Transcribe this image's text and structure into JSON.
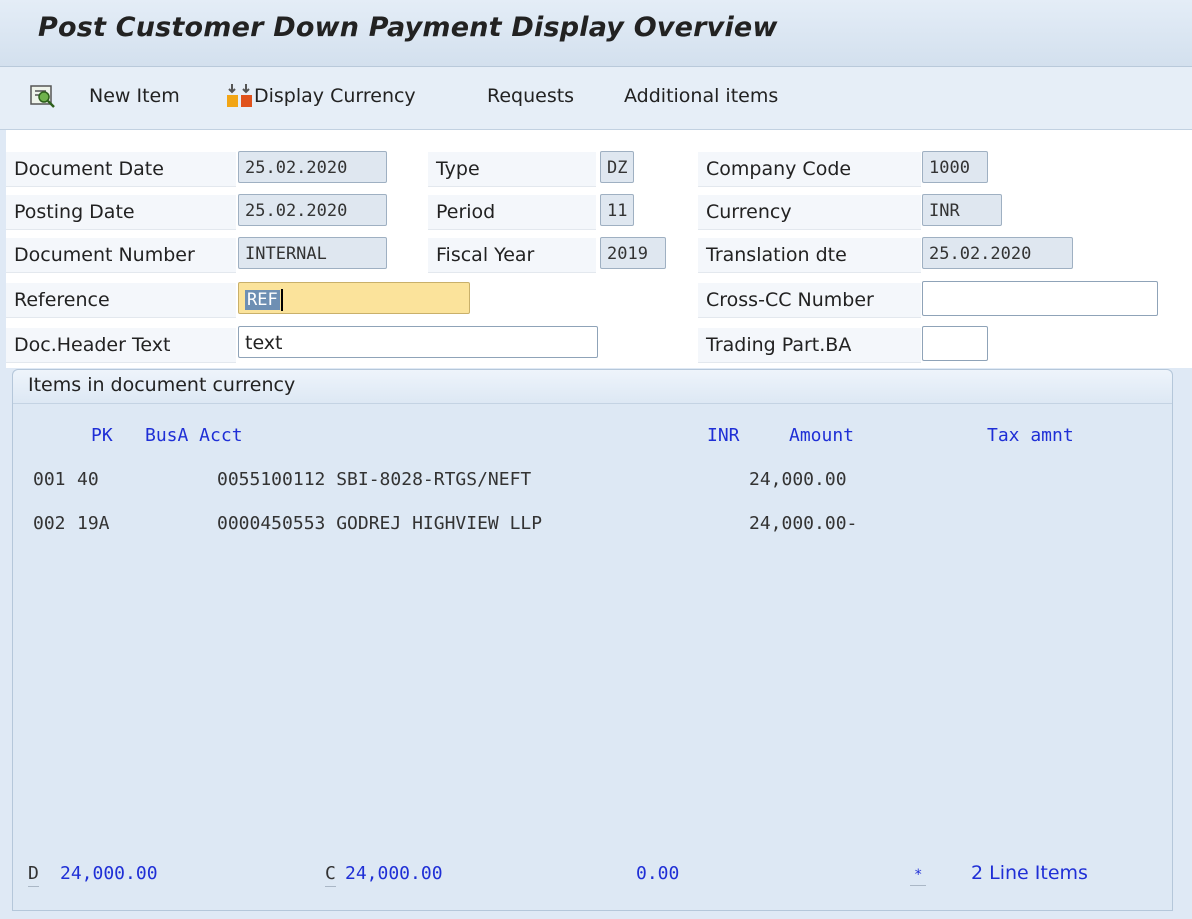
{
  "window": {
    "title": "Post Customer Down Payment Display Overview"
  },
  "toolbar": {
    "new_item": "New Item",
    "display_currency": "Display Currency",
    "requests": "Requests",
    "additional_items": "Additional items"
  },
  "header": {
    "document_date": {
      "label": "Document Date",
      "value": "25.02.2020"
    },
    "posting_date": {
      "label": "Posting Date",
      "value": "25.02.2020"
    },
    "document_number": {
      "label": "Document Number",
      "value": "INTERNAL"
    },
    "reference": {
      "label": "Reference",
      "value": "REF"
    },
    "doc_header_text": {
      "label": "Doc.Header Text",
      "value": "text"
    },
    "type": {
      "label": "Type",
      "value": "DZ"
    },
    "period": {
      "label": "Period",
      "value": "11"
    },
    "fiscal_year": {
      "label": "Fiscal Year",
      "value": "2019"
    },
    "company_code": {
      "label": "Company Code",
      "value": "1000"
    },
    "currency": {
      "label": "Currency",
      "value": "INR"
    },
    "translation_date": {
      "label": "Translation dte",
      "value": "25.02.2020"
    },
    "cross_cc_number": {
      "label": "Cross-CC Number",
      "value": ""
    },
    "trading_part_ba": {
      "label": "Trading Part.BA",
      "value": ""
    }
  },
  "items": {
    "panel_title": "Items in document currency",
    "columns": {
      "pk": "PK",
      "busa_acct": "BusA Acct",
      "currency": "INR",
      "amount": "Amount",
      "tax_amount": "Tax amnt"
    },
    "rows": [
      {
        "no": "001",
        "pk": "40",
        "acct": "0055100112 SBI-8028-RTGS/NEFT",
        "amount": "24,000.00"
      },
      {
        "no": "002",
        "pk": "19A",
        "acct": "0000450553 GODREJ HIGHVIEW LLP",
        "amount": "24,000.00-"
      }
    ],
    "totals": {
      "debit_label": "D",
      "debit": "24,000.00",
      "credit_label": "C",
      "credit": "24,000.00",
      "balance": "0.00",
      "star": "*",
      "line_items": "2 Line Items"
    }
  }
}
